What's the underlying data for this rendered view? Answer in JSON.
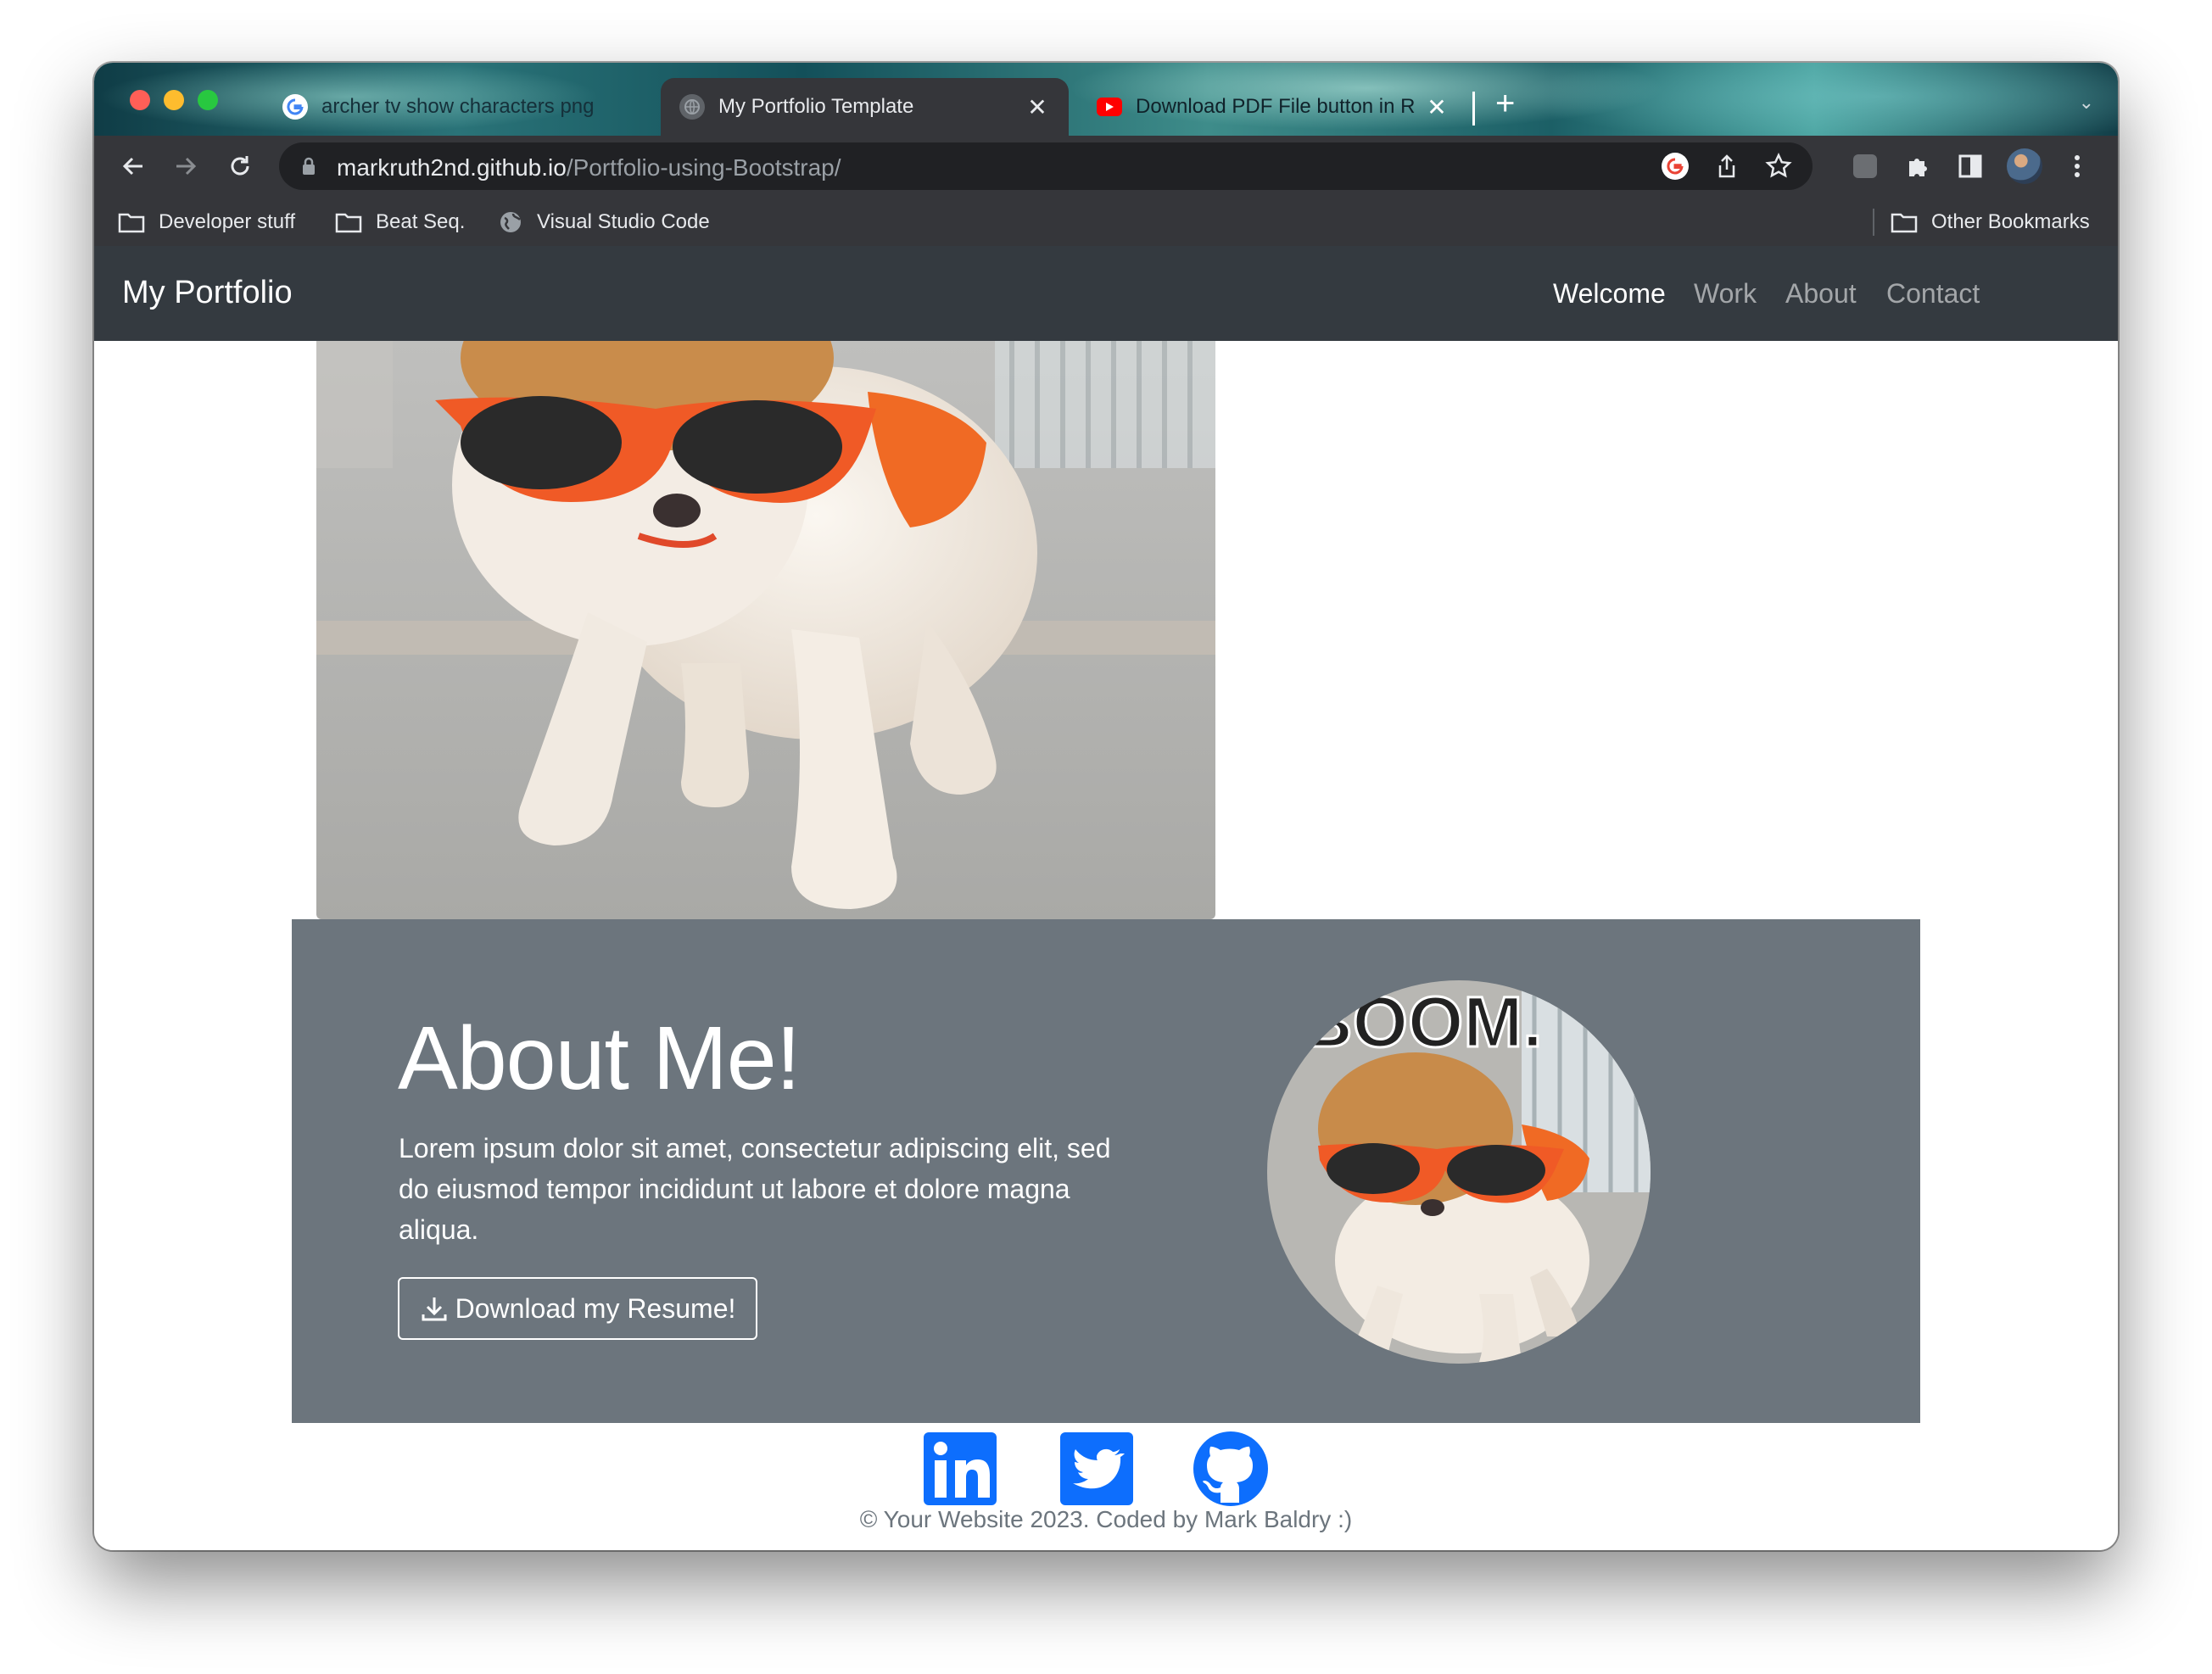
{
  "browser": {
    "tabs": [
      {
        "title": "archer tv show characters png",
        "favicon": "google-icon",
        "active": false
      },
      {
        "title": "My Portfolio Template",
        "favicon": "globe-icon",
        "active": true
      },
      {
        "title": "Download PDF File button in R",
        "favicon": "youtube-icon",
        "active": false
      }
    ],
    "new_tab_label": "+",
    "close_glyph": "✕",
    "url_host": "markruth2nd.github.io",
    "url_path": "/Portfolio-using-Bootstrap/",
    "bookmarks": [
      {
        "label": "Developer stuff",
        "icon": "folder-icon"
      },
      {
        "label": "Beat Seq.",
        "icon": "folder-icon"
      },
      {
        "label": "Visual Studio Code",
        "icon": "globe-icon"
      }
    ],
    "other_bookmarks": "Other Bookmarks"
  },
  "navbar": {
    "brand": "My Portfolio",
    "links": [
      {
        "label": "Welcome",
        "active": true
      },
      {
        "label": "Work",
        "active": false
      },
      {
        "label": "About",
        "active": false
      },
      {
        "label": "Contact",
        "active": false
      }
    ]
  },
  "about": {
    "title": "About Me!",
    "text": "Lorem ipsum dolor sit amet, consectetur adipiscing elit, sed do eiusmod tempor incididunt ut labore et dolore magna aliqua.",
    "button": "Download my Resume!",
    "avatar_caption": "BOOM."
  },
  "socials": [
    {
      "name": "linkedin-icon"
    },
    {
      "name": "twitter-icon"
    },
    {
      "name": "github-icon"
    }
  ],
  "footer": "© Your Website 2023. Coded by Mark Baldry :)",
  "colors": {
    "navbar": "#343a40",
    "about_bg": "#6c757d",
    "social_blue": "#0d6efd",
    "tab_active": "#35363a"
  }
}
